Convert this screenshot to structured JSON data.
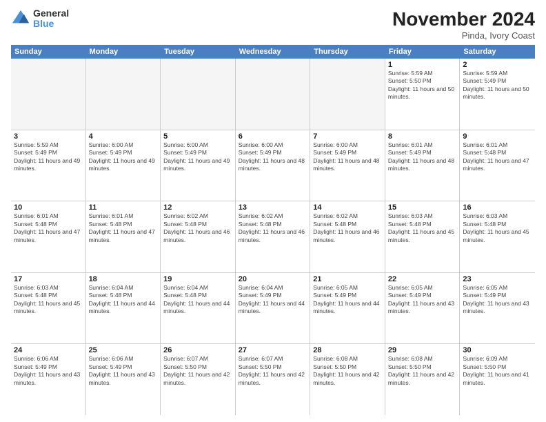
{
  "logo": {
    "general": "General",
    "blue": "Blue"
  },
  "title": "November 2024",
  "subtitle": "Pinda, Ivory Coast",
  "days": [
    "Sunday",
    "Monday",
    "Tuesday",
    "Wednesday",
    "Thursday",
    "Friday",
    "Saturday"
  ],
  "weeks": [
    [
      {
        "day": "",
        "info": "",
        "empty": true
      },
      {
        "day": "",
        "info": "",
        "empty": true
      },
      {
        "day": "",
        "info": "",
        "empty": true
      },
      {
        "day": "",
        "info": "",
        "empty": true
      },
      {
        "day": "",
        "info": "",
        "empty": true
      },
      {
        "day": "1",
        "info": "Sunrise: 5:59 AM\nSunset: 5:50 PM\nDaylight: 11 hours and 50 minutes."
      },
      {
        "day": "2",
        "info": "Sunrise: 5:59 AM\nSunset: 5:49 PM\nDaylight: 11 hours and 50 minutes."
      }
    ],
    [
      {
        "day": "3",
        "info": "Sunrise: 5:59 AM\nSunset: 5:49 PM\nDaylight: 11 hours and 49 minutes."
      },
      {
        "day": "4",
        "info": "Sunrise: 6:00 AM\nSunset: 5:49 PM\nDaylight: 11 hours and 49 minutes."
      },
      {
        "day": "5",
        "info": "Sunrise: 6:00 AM\nSunset: 5:49 PM\nDaylight: 11 hours and 49 minutes."
      },
      {
        "day": "6",
        "info": "Sunrise: 6:00 AM\nSunset: 5:49 PM\nDaylight: 11 hours and 48 minutes."
      },
      {
        "day": "7",
        "info": "Sunrise: 6:00 AM\nSunset: 5:49 PM\nDaylight: 11 hours and 48 minutes."
      },
      {
        "day": "8",
        "info": "Sunrise: 6:01 AM\nSunset: 5:49 PM\nDaylight: 11 hours and 48 minutes."
      },
      {
        "day": "9",
        "info": "Sunrise: 6:01 AM\nSunset: 5:48 PM\nDaylight: 11 hours and 47 minutes."
      }
    ],
    [
      {
        "day": "10",
        "info": "Sunrise: 6:01 AM\nSunset: 5:48 PM\nDaylight: 11 hours and 47 minutes."
      },
      {
        "day": "11",
        "info": "Sunrise: 6:01 AM\nSunset: 5:48 PM\nDaylight: 11 hours and 47 minutes."
      },
      {
        "day": "12",
        "info": "Sunrise: 6:02 AM\nSunset: 5:48 PM\nDaylight: 11 hours and 46 minutes."
      },
      {
        "day": "13",
        "info": "Sunrise: 6:02 AM\nSunset: 5:48 PM\nDaylight: 11 hours and 46 minutes."
      },
      {
        "day": "14",
        "info": "Sunrise: 6:02 AM\nSunset: 5:48 PM\nDaylight: 11 hours and 46 minutes."
      },
      {
        "day": "15",
        "info": "Sunrise: 6:03 AM\nSunset: 5:48 PM\nDaylight: 11 hours and 45 minutes."
      },
      {
        "day": "16",
        "info": "Sunrise: 6:03 AM\nSunset: 5:48 PM\nDaylight: 11 hours and 45 minutes."
      }
    ],
    [
      {
        "day": "17",
        "info": "Sunrise: 6:03 AM\nSunset: 5:48 PM\nDaylight: 11 hours and 45 minutes."
      },
      {
        "day": "18",
        "info": "Sunrise: 6:04 AM\nSunset: 5:48 PM\nDaylight: 11 hours and 44 minutes."
      },
      {
        "day": "19",
        "info": "Sunrise: 6:04 AM\nSunset: 5:48 PM\nDaylight: 11 hours and 44 minutes."
      },
      {
        "day": "20",
        "info": "Sunrise: 6:04 AM\nSunset: 5:49 PM\nDaylight: 11 hours and 44 minutes."
      },
      {
        "day": "21",
        "info": "Sunrise: 6:05 AM\nSunset: 5:49 PM\nDaylight: 11 hours and 44 minutes."
      },
      {
        "day": "22",
        "info": "Sunrise: 6:05 AM\nSunset: 5:49 PM\nDaylight: 11 hours and 43 minutes."
      },
      {
        "day": "23",
        "info": "Sunrise: 6:05 AM\nSunset: 5:49 PM\nDaylight: 11 hours and 43 minutes."
      }
    ],
    [
      {
        "day": "24",
        "info": "Sunrise: 6:06 AM\nSunset: 5:49 PM\nDaylight: 11 hours and 43 minutes."
      },
      {
        "day": "25",
        "info": "Sunrise: 6:06 AM\nSunset: 5:49 PM\nDaylight: 11 hours and 43 minutes."
      },
      {
        "day": "26",
        "info": "Sunrise: 6:07 AM\nSunset: 5:50 PM\nDaylight: 11 hours and 42 minutes."
      },
      {
        "day": "27",
        "info": "Sunrise: 6:07 AM\nSunset: 5:50 PM\nDaylight: 11 hours and 42 minutes."
      },
      {
        "day": "28",
        "info": "Sunrise: 6:08 AM\nSunset: 5:50 PM\nDaylight: 11 hours and 42 minutes."
      },
      {
        "day": "29",
        "info": "Sunrise: 6:08 AM\nSunset: 5:50 PM\nDaylight: 11 hours and 42 minutes."
      },
      {
        "day": "30",
        "info": "Sunrise: 6:09 AM\nSunset: 5:50 PM\nDaylight: 11 hours and 41 minutes."
      }
    ]
  ]
}
